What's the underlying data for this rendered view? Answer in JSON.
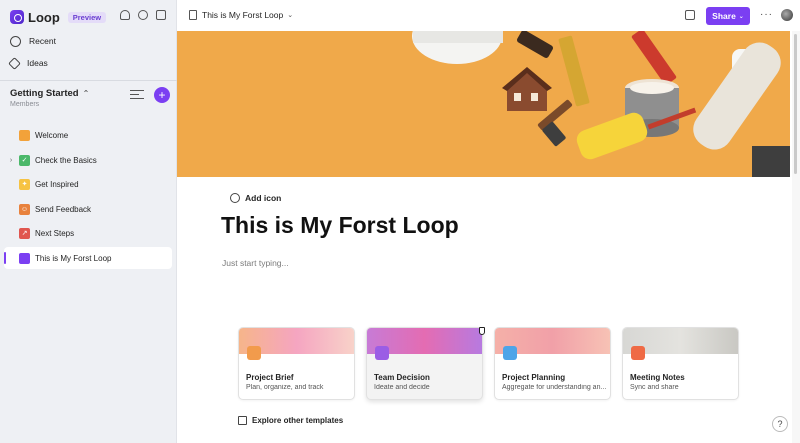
{
  "app": {
    "name": "Loop",
    "badge": "Preview"
  },
  "nav": [
    {
      "label": "Recent",
      "icon": "clock-icon"
    },
    {
      "label": "Ideas",
      "icon": "pen-icon"
    }
  ],
  "workspace": {
    "title": "Getting Started",
    "subtitle": "Members",
    "add": "+"
  },
  "pages": [
    {
      "label": "Welcome",
      "icon": "wave-hand-icon",
      "icon_color": "#f2a23a",
      "glyph": "",
      "expand": ""
    },
    {
      "label": "Check the Basics",
      "icon": "check-icon",
      "icon_color": "#4bb86a",
      "glyph": "✓",
      "expand": "›"
    },
    {
      "label": "Get Inspired",
      "icon": "sparkle-icon",
      "icon_color": "#f6c343",
      "glyph": "✦",
      "expand": ""
    },
    {
      "label": "Send Feedback",
      "icon": "smile-icon",
      "icon_color": "#e8823d",
      "glyph": "☺",
      "expand": ""
    },
    {
      "label": "Next Steps",
      "icon": "arrow-icon",
      "icon_color": "#e0564f",
      "glyph": "↗",
      "expand": ""
    },
    {
      "label": "This is My Forst Loop",
      "icon": "document-icon",
      "icon_color": "#7b3ff2",
      "glyph": "",
      "expand": "",
      "active": true
    }
  ],
  "topbar": {
    "title": "This is My Forst Loop",
    "share": "Share",
    "more": "···"
  },
  "content": {
    "add_icon": "Add icon",
    "title": "This is My Forst Loop",
    "placeholder": "Just start typing..."
  },
  "templates": [
    {
      "title": "Project Brief",
      "sub": "Plan, organize, and track",
      "gradient": "linear-gradient(90deg,#f6b58a,#f5a5c1,#f8d2c9)",
      "icon_color": "#f29b4c"
    },
    {
      "title": "Team Decision",
      "sub": "Ideate and decide",
      "gradient": "linear-gradient(90deg,#c77bd6,#e46cb2,#b77ae0)",
      "icon_color": "#9b5de5"
    },
    {
      "title": "Project Planning",
      "sub": "Aggregate for understanding an...",
      "gradient": "linear-gradient(90deg,#f5b0a8,#f1a0a8,#f7c2b5)",
      "icon_color": "#4ea4e8"
    },
    {
      "title": "Meeting Notes",
      "sub": "Sync and share",
      "gradient": "linear-gradient(90deg,#d7d7d4,#e4e3df,#c9c8c3)",
      "icon_color": "#ef6a45"
    }
  ],
  "explore": "Explore other templates",
  "help": "?"
}
